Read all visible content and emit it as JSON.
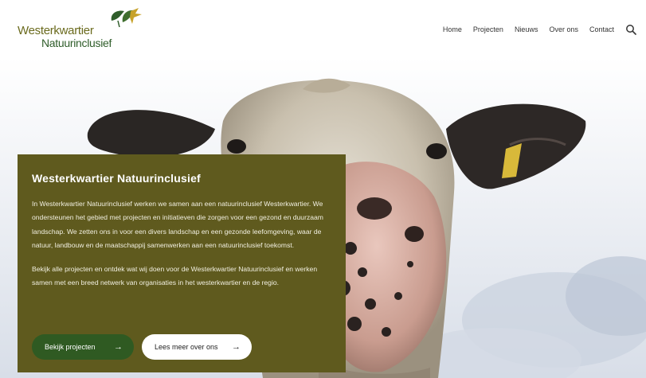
{
  "logo": {
    "line1": "Westerkwartier",
    "line2": "Natuurinclusief"
  },
  "nav": {
    "items": [
      "Home",
      "Projecten",
      "Nieuws",
      "Over ons",
      "Contact"
    ],
    "search_icon": "search-icon"
  },
  "hero": {
    "title": "Westerkwartier Natuurinclusief",
    "paragraph1": "In Westerkwartier Natuurinclusief werken we samen aan een natuurinclusief Westerkwartier. We ondersteunen het gebied met projecten en initiatieven die zorgen voor een gezond en duurzaam landschap. We zetten ons in voor een divers landschap en een gezonde leefomgeving, waar de natuur, landbouw en de maatschappij samenwerken aan een natuurinclusief toekomst.",
    "paragraph2": "Bekijk alle projecten en ontdek wat wij doen voor de Westerkwartier Natuurinclusief en werken samen met een breed netwerk van organisaties in het westerkwartier en de regio.",
    "button_primary": "Bekijk projecten",
    "button_secondary": "Lees meer over ons"
  },
  "colors": {
    "card_bg": "#5f5a1e",
    "button_primary_bg": "#2f5a22",
    "logo_olive": "#6b6b1e",
    "logo_green": "#2f5d2a"
  }
}
